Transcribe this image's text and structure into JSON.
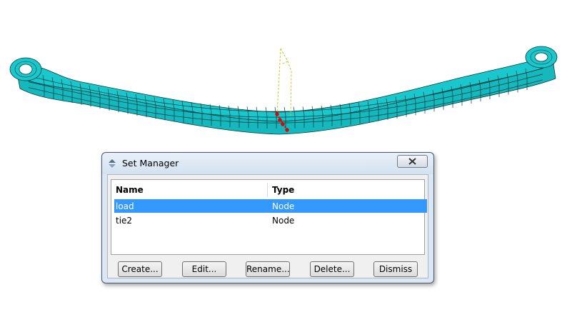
{
  "colors": {
    "mesh_fill": "#18c8cc",
    "mesh_line": "#0a3a3c",
    "selection": "#3399ff",
    "load_nodes": "#e00000",
    "guide_line": "#c8c832"
  },
  "viewport": {
    "model": "leaf-spring-mesh"
  },
  "dialog": {
    "title": "Set Manager",
    "close_icon": "close-x-icon",
    "columns": [
      "Name",
      "Type"
    ],
    "rows": [
      {
        "name": "load",
        "type": "Node",
        "selected": true
      },
      {
        "name": "tie2",
        "type": "Node",
        "selected": false
      }
    ],
    "buttons": {
      "create": "Create...",
      "edit": "Edit...",
      "rename": "Rename...",
      "delete": "Delete...",
      "dismiss": "Dismiss"
    }
  }
}
